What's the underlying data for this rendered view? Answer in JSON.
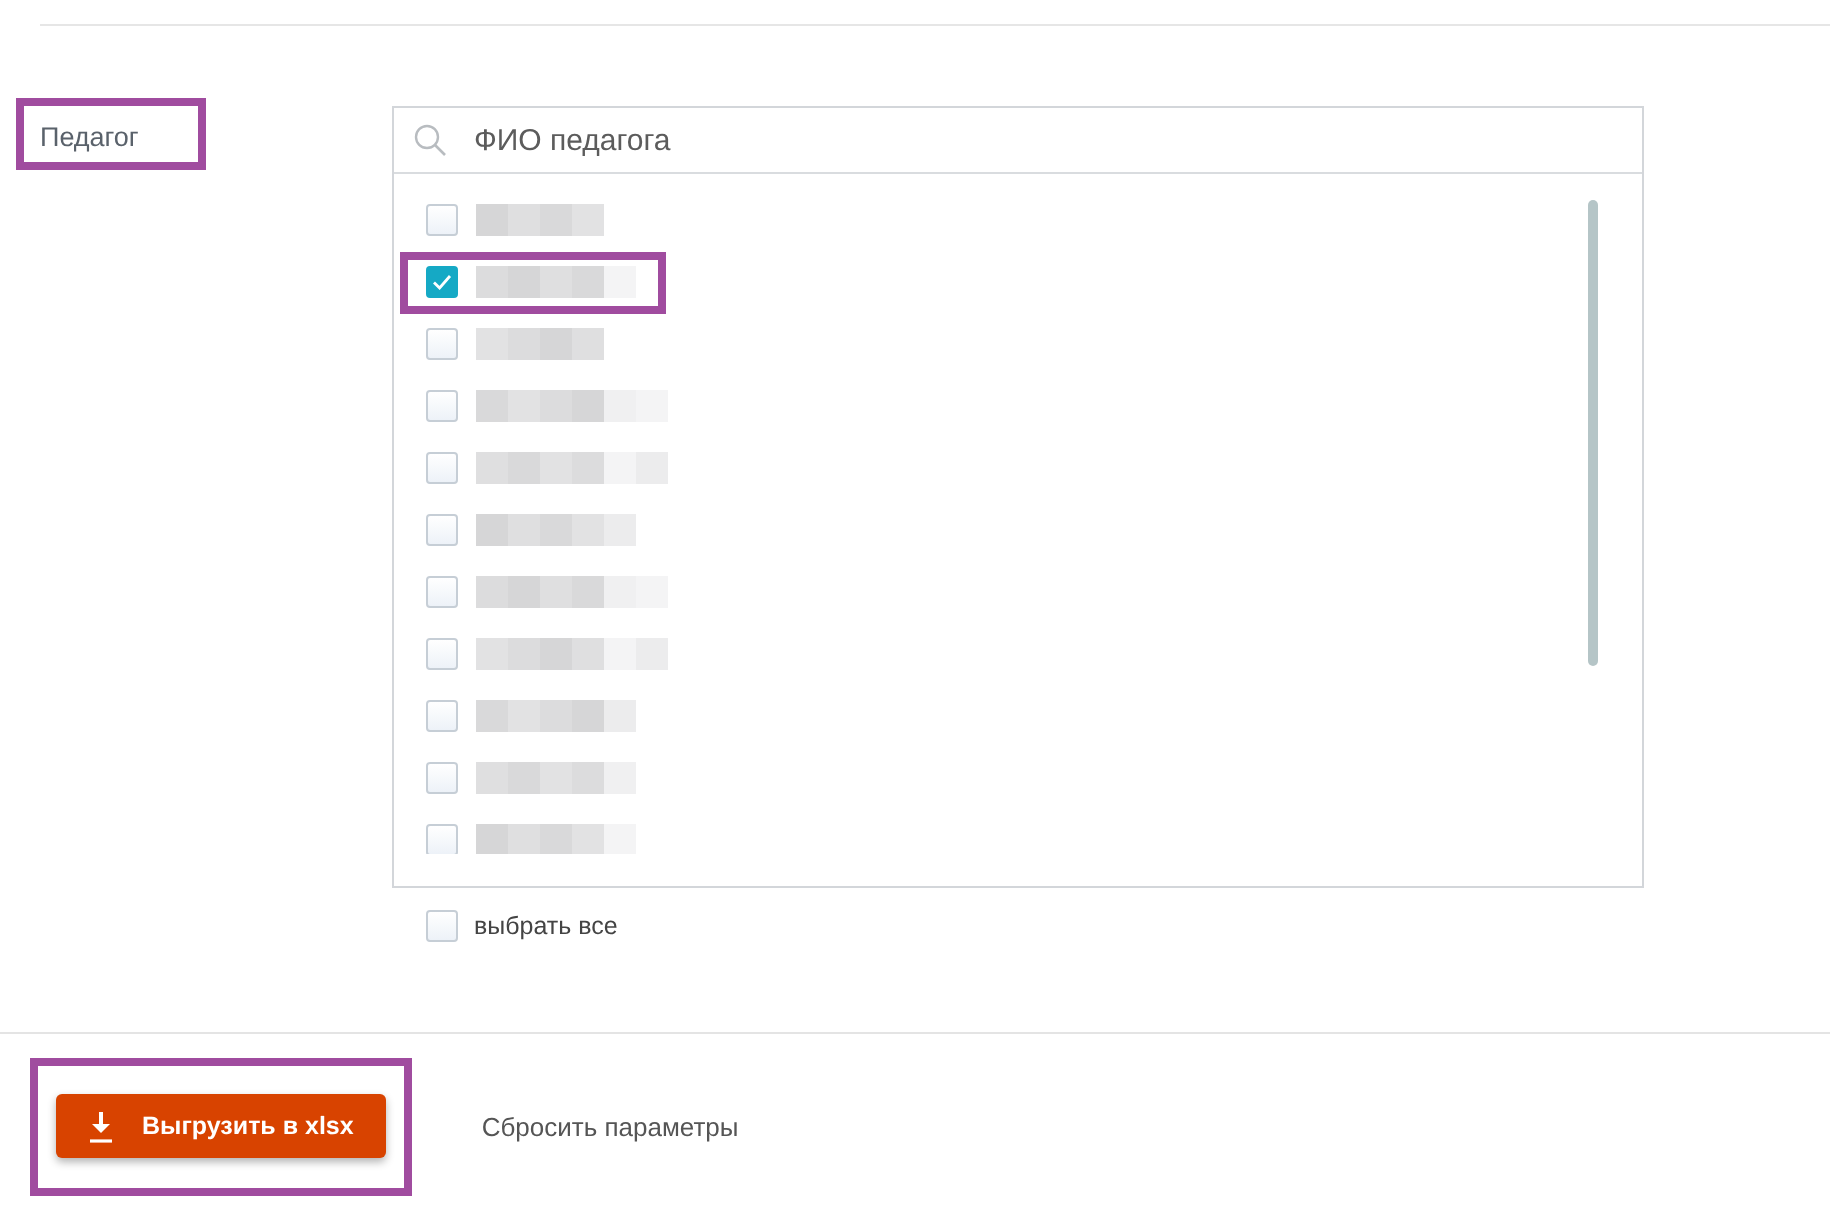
{
  "filter": {
    "label": "Педагог",
    "highlighted": true,
    "search": {
      "placeholder": "ФИО педагога"
    },
    "items": [
      {
        "checked": false,
        "highlighted": false
      },
      {
        "checked": true,
        "highlighted": true
      },
      {
        "checked": false,
        "highlighted": false
      },
      {
        "checked": false,
        "highlighted": false
      },
      {
        "checked": false,
        "highlighted": false
      },
      {
        "checked": false,
        "highlighted": false
      },
      {
        "checked": false,
        "highlighted": false
      },
      {
        "checked": false,
        "highlighted": false
      },
      {
        "checked": false,
        "highlighted": false
      },
      {
        "checked": false,
        "highlighted": false
      },
      {
        "checked": false,
        "highlighted": false
      }
    ],
    "select_all": {
      "label": "выбрать все",
      "checked": false
    }
  },
  "actions": {
    "export_button": {
      "label": "Выгрузить в xlsx",
      "highlighted": true
    },
    "reset_link": {
      "label": "Сбросить параметры"
    }
  }
}
